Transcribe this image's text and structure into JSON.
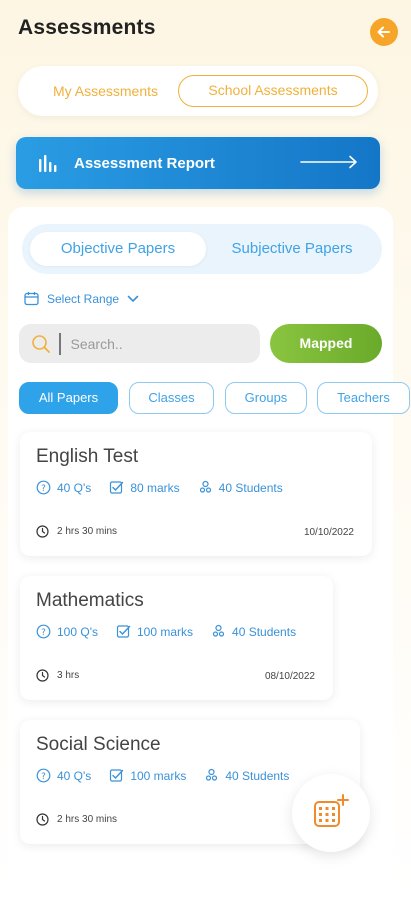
{
  "header": {
    "title": "Assessments",
    "back_icon": "arrow-left-icon",
    "accent": "#f7a528"
  },
  "assessment_tabs": {
    "my": "My Assessments",
    "school": "School Assessments",
    "selected": "School Assessments"
  },
  "report_button": {
    "label": "Assessment Report",
    "icon": "bar-chart-icon"
  },
  "paper_tabs": {
    "objective": "Objective Papers",
    "subjective": "Subjective Papers",
    "selected": "Objective Papers"
  },
  "range": {
    "label": "Select Range"
  },
  "search": {
    "placeholder": "Search..",
    "mapped_label": "Mapped"
  },
  "filters": [
    {
      "label": "All Papers",
      "active": true
    },
    {
      "label": "Classes",
      "active": false
    },
    {
      "label": "Groups",
      "active": false
    },
    {
      "label": "Teachers",
      "active": false
    }
  ],
  "cards": [
    {
      "name": "English Test",
      "questions": "40 Q's",
      "marks": "80 marks",
      "students": "40 Students",
      "duration": "2 hrs 30 mins",
      "date": "10/10/2022"
    },
    {
      "name": "Mathematics",
      "questions": "100 Q's",
      "marks": "100 marks",
      "students": "40 Students",
      "duration": "3 hrs",
      "date": "08/10/2022"
    },
    {
      "name": "Social Science",
      "questions": "40 Q's",
      "marks": "100 marks",
      "students": "40 Students",
      "duration": "2 hrs 30 mins",
      "date": ""
    }
  ],
  "fab": {
    "icon": "calendar-add-icon"
  }
}
